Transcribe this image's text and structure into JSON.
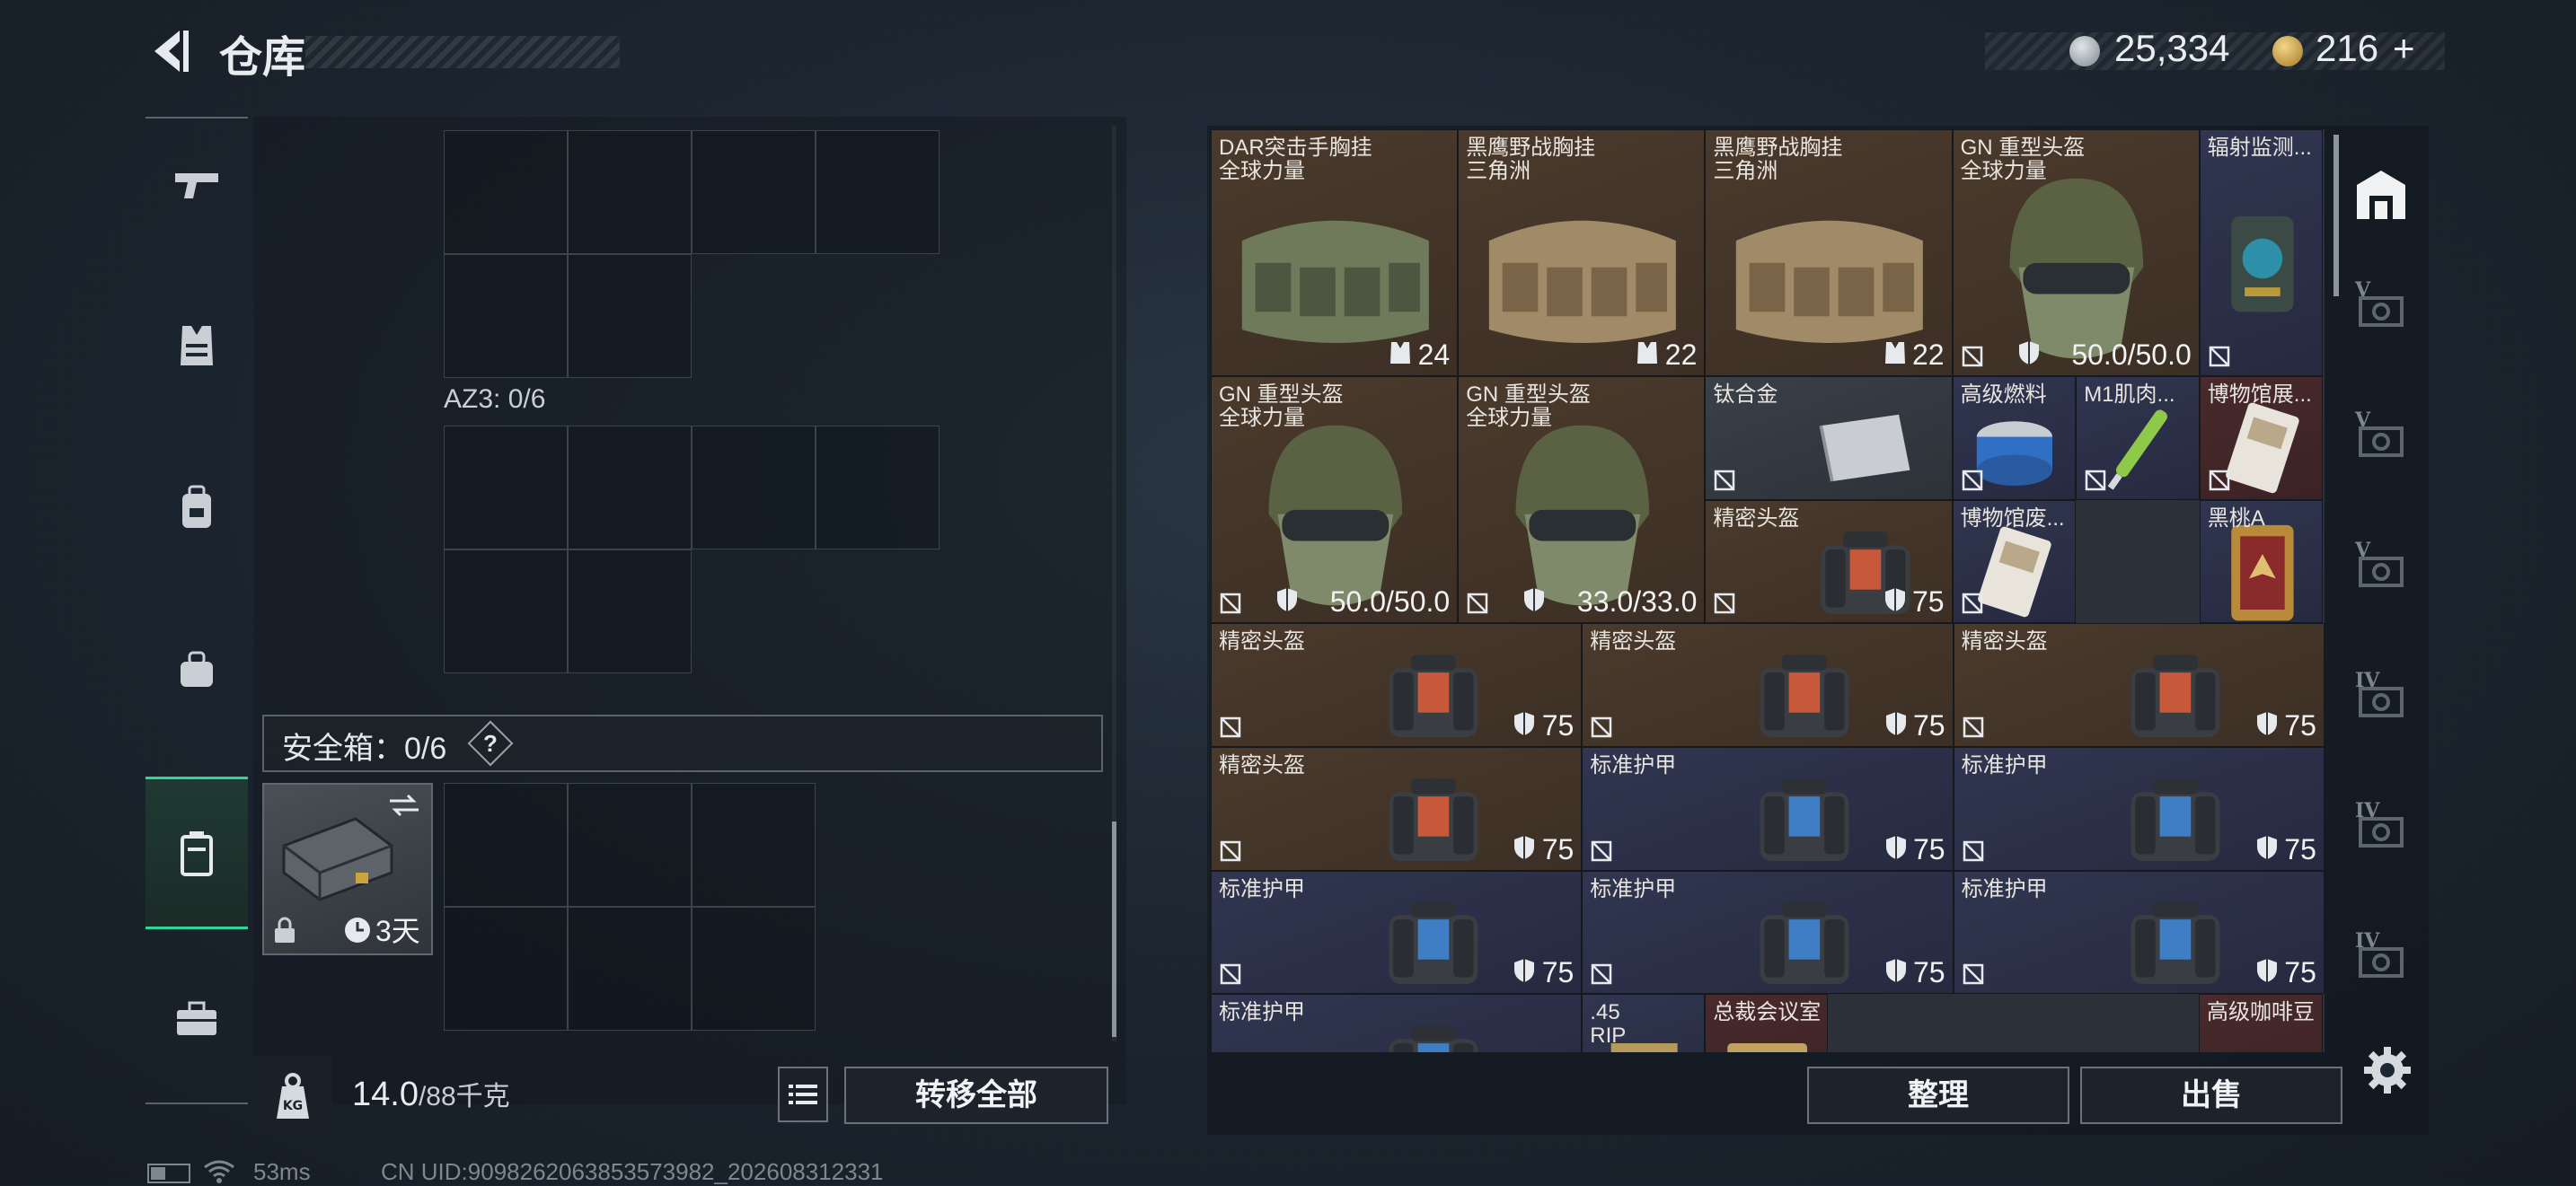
{
  "header": {
    "title": "仓库"
  },
  "currency": {
    "silver": "25,334",
    "gold": "216",
    "plus": "+"
  },
  "left_panel": {
    "az3_label": "AZ3: 0/6",
    "safebox_label": "安全箱：0/6",
    "safebox_help": "?",
    "safebox_time": "3天"
  },
  "bottom_left": {
    "weight_value": "14.0",
    "weight_cap": "/88千克",
    "transfer_label": "转移全部"
  },
  "inventory": {
    "items": [
      {
        "name": "DAR突击手胸挂",
        "sub": "全球力量",
        "value": "24",
        "color": "brown",
        "art": "rig-green"
      },
      {
        "name": "黑鹰野战胸挂",
        "sub": "三角洲",
        "value": "22",
        "color": "brown",
        "art": "rig-tan"
      },
      {
        "name": "黑鹰野战胸挂",
        "sub": "三角洲",
        "value": "22",
        "color": "brown",
        "art": "rig-tan"
      },
      {
        "name": "GN 重型头盔",
        "sub": "全球力量",
        "value": "50.0/50.0",
        "color": "brown",
        "art": "helmet"
      },
      {
        "name": "辐射监测...",
        "sub": "",
        "value": "",
        "color": "navy",
        "art": "device"
      },
      {
        "name": "GN 重型头盔",
        "sub": "全球力量",
        "value": "50.0/50.0",
        "color": "brown",
        "art": "helmet"
      },
      {
        "name": "GN 重型头盔",
        "sub": "全球力量",
        "value": "33.0/33.0",
        "color": "brown",
        "art": "helmet"
      },
      {
        "name": "钛合金",
        "sub": "",
        "value": "",
        "color": "grey",
        "art": "plate"
      },
      {
        "name": "高级燃料",
        "sub": "",
        "value": "",
        "color": "navy",
        "art": "can"
      },
      {
        "name": "M1肌肉...",
        "sub": "",
        "value": "",
        "color": "navy",
        "art": "syringe"
      },
      {
        "name": "博物馆展...",
        "sub": "",
        "value": "",
        "color": "red",
        "art": "card"
      },
      {
        "name": "精密头盔",
        "sub": "",
        "value": "75",
        "color": "brown",
        "art": "bag-orange"
      },
      {
        "name": "博物馆废...",
        "sub": "",
        "value": "",
        "color": "navy",
        "art": "card"
      },
      {
        "name": "黑桃A",
        "sub": "",
        "value": "",
        "color": "navy",
        "art": "playing-card"
      },
      {
        "name": "精密头盔",
        "sub": "",
        "value": "75",
        "color": "brown",
        "art": "bag-orange"
      },
      {
        "name": "精密头盔",
        "sub": "",
        "value": "75",
        "color": "brown",
        "art": "bag-orange"
      },
      {
        "name": "精密头盔",
        "sub": "",
        "value": "75",
        "color": "brown",
        "art": "bag-orange"
      },
      {
        "name": "精密头盔",
        "sub": "",
        "value": "75",
        "color": "brown",
        "art": "bag-orange"
      },
      {
        "name": "标准护甲",
        "sub": "",
        "value": "75",
        "color": "navy",
        "art": "bag-blue"
      },
      {
        "name": "标准护甲",
        "sub": "",
        "value": "75",
        "color": "navy",
        "art": "bag-blue"
      },
      {
        "name": "标准护甲",
        "sub": "",
        "value": "75",
        "color": "navy",
        "art": "bag-blue"
      },
      {
        "name": "标准护甲",
        "sub": "",
        "value": "75",
        "color": "navy",
        "art": "bag-blue"
      },
      {
        "name": "标准护甲",
        "sub": "",
        "value": "75",
        "color": "navy",
        "art": "bag-blue"
      },
      {
        "name": "标准护甲",
        "sub": "",
        "value": "",
        "color": "navy",
        "art": "bag-blue"
      },
      {
        "name": ".45",
        "sub": "RIP",
        "value": "",
        "color": "navy",
        "art": "ammo"
      },
      {
        "name": "总裁会议室",
        "sub": "",
        "value": "",
        "color": "red",
        "art": "keycard"
      },
      {
        "name": "高级咖啡豆",
        "sub": "",
        "value": "",
        "color": "red",
        "art": "none"
      }
    ]
  },
  "right_sidebar": {
    "tiers": [
      "V",
      "V",
      "V",
      "IV",
      "IV",
      "IV"
    ]
  },
  "bottom_right": {
    "sort_label": "整理",
    "sell_label": "出售"
  },
  "status_bar": {
    "ping": "53ms",
    "uid": "CN UID:9098262063853573982_202608312331"
  },
  "colors": {
    "accent": "#2fd69a",
    "brown": "#4a3a2c",
    "navy": "#303650",
    "red": "#4a2a2c"
  }
}
